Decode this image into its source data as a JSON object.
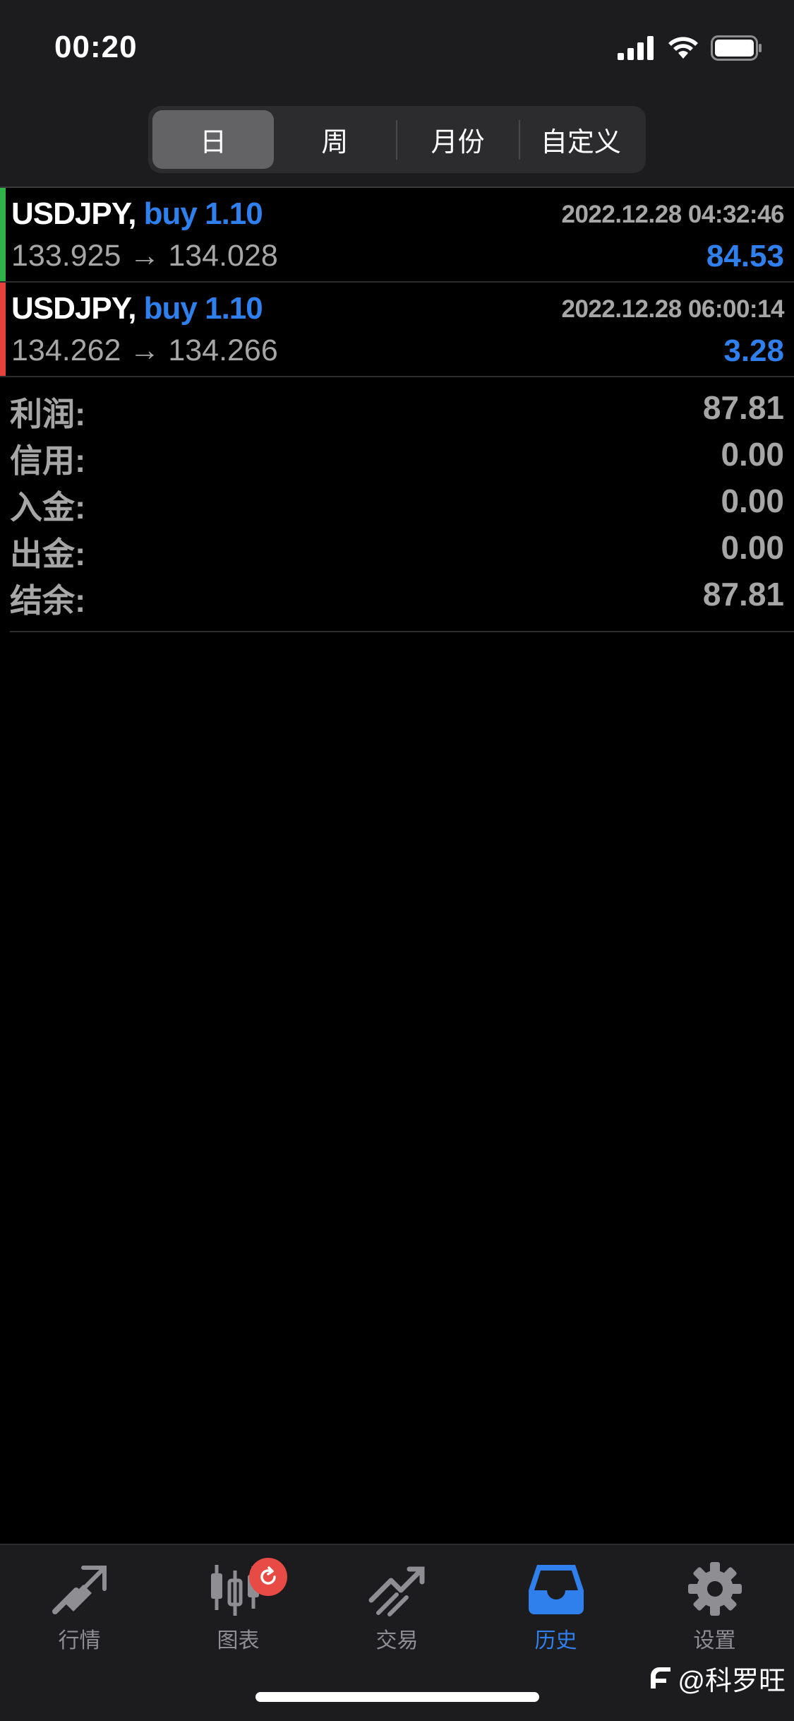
{
  "status_bar": {
    "time": "00:20"
  },
  "segments": [
    {
      "label": "日",
      "selected": true
    },
    {
      "label": "周",
      "selected": false
    },
    {
      "label": "月份",
      "selected": false
    },
    {
      "label": "自定义",
      "selected": false
    }
  ],
  "deals": [
    {
      "symbol": "USDJPY,",
      "action": "buy 1.10",
      "datetime": "2022.12.28 04:32:46",
      "prices": "133.925 → 134.028",
      "profit": "84.53",
      "side_color": "#2fb24a"
    },
    {
      "symbol": "USDJPY,",
      "action": "buy 1.10",
      "datetime": "2022.12.28 06:00:14",
      "prices": "134.262 → 134.266",
      "profit": "3.28",
      "side_color": "#e5423b"
    }
  ],
  "summary": [
    {
      "label": "利润:",
      "value": "87.81"
    },
    {
      "label": "信用:",
      "value": "0.00"
    },
    {
      "label": "入金:",
      "value": "0.00"
    },
    {
      "label": "出金:",
      "value": "0.00"
    },
    {
      "label": "结余:",
      "value": "87.81"
    }
  ],
  "tabs": [
    {
      "label": "行情",
      "icon": "quotes-icon",
      "active": false
    },
    {
      "label": "图表",
      "icon": "chart-icon",
      "active": false
    },
    {
      "label": "交易",
      "icon": "trade-icon",
      "active": false
    },
    {
      "label": "历史",
      "icon": "history-icon",
      "active": true
    },
    {
      "label": "设置",
      "icon": "settings-icon",
      "active": false
    }
  ],
  "watermark": "@科罗旺",
  "colors": {
    "accent": "#2f80ed",
    "buy_bar": "#2fb24a",
    "sell_bar": "#e5423b",
    "badge": "#e84a45"
  }
}
